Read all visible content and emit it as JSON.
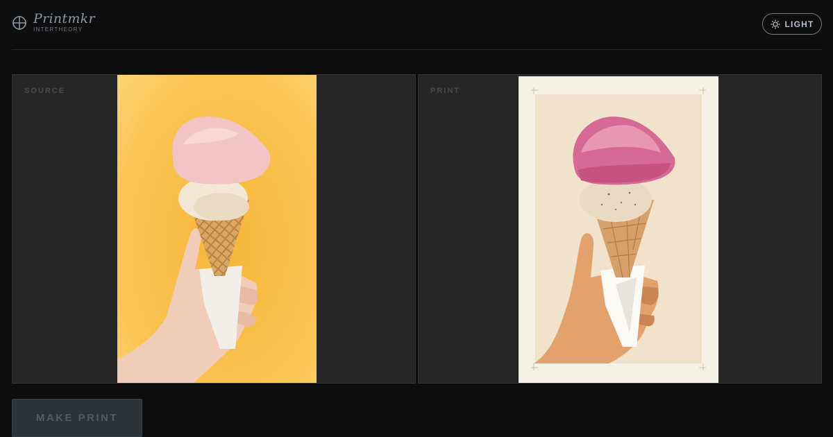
{
  "brand": {
    "name": "Printmkr",
    "subtitle": "INTERTHEORY",
    "icon": "crosshair-circle-icon"
  },
  "theme_toggle": {
    "label": "LIGHT",
    "icon": "sun-icon"
  },
  "panels": {
    "source": {
      "label": "SOURCE",
      "image": "photo: hand holding ice cream cone (pink and vanilla scoops) on yellow background"
    },
    "print": {
      "label": "PRINT",
      "image": "illustrated print: hand holding ice cream cone on cream background"
    }
  },
  "actions": {
    "make_print_label": "MAKE PRINT"
  },
  "colors": {
    "background": "#0d0d0d",
    "panel": "#262626",
    "accent": "#8a96a6",
    "source_bg": "#f7c15a",
    "print_bg": "#f1e2cb"
  }
}
